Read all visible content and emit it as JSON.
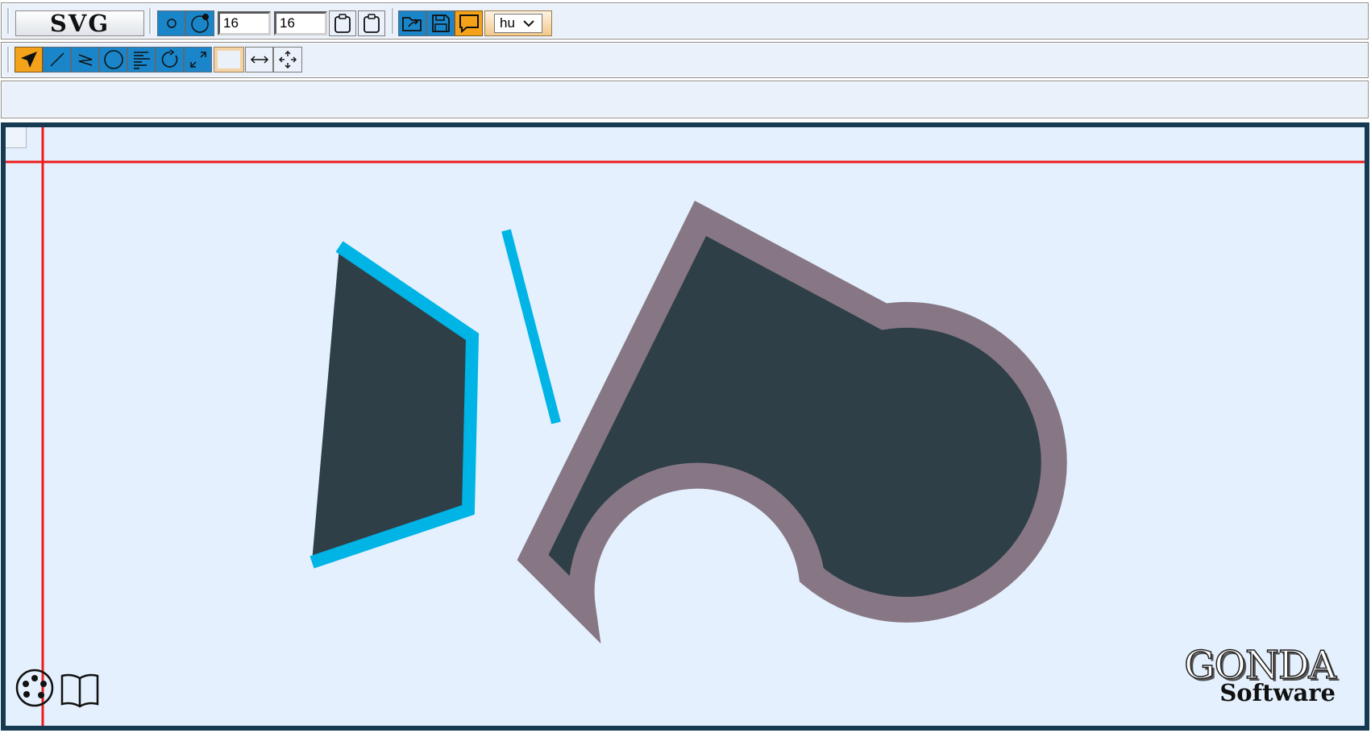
{
  "toolbar1": {
    "svg_label": "SVG",
    "width_value": "16",
    "height_value": "16",
    "language": "hu"
  },
  "logo": {
    "line1": "GONDA",
    "line2": "Software"
  },
  "colors": {
    "toolbar_bg": "#eaf1fa",
    "button_blue": "#1a86c9",
    "button_orange": "#f5a21b",
    "canvas_bg": "#e4f0fd",
    "canvas_border": "#163a52",
    "guide_red": "#ee1c1c",
    "shape_fill": "#2e3f47",
    "polyline_stroke": "#00b4e6",
    "shape_stroke": "#877785"
  },
  "icons": {
    "toolbar1": [
      "small-circle-icon",
      "circle-with-dot-icon",
      "clipboard-icon",
      "clipboard-icon",
      "open-folder-icon",
      "save-disk-icon",
      "speech-bubble-icon"
    ],
    "toolbar2": [
      "select-arrow-icon",
      "line-icon",
      "polyline-icon",
      "circle-icon",
      "align-text-icon",
      "rotate-icon",
      "resize-icon",
      "color-swatch",
      "horizontal-arrow-icon",
      "move-icon"
    ],
    "canvas": [
      "palette-icon",
      "book-icon"
    ]
  }
}
